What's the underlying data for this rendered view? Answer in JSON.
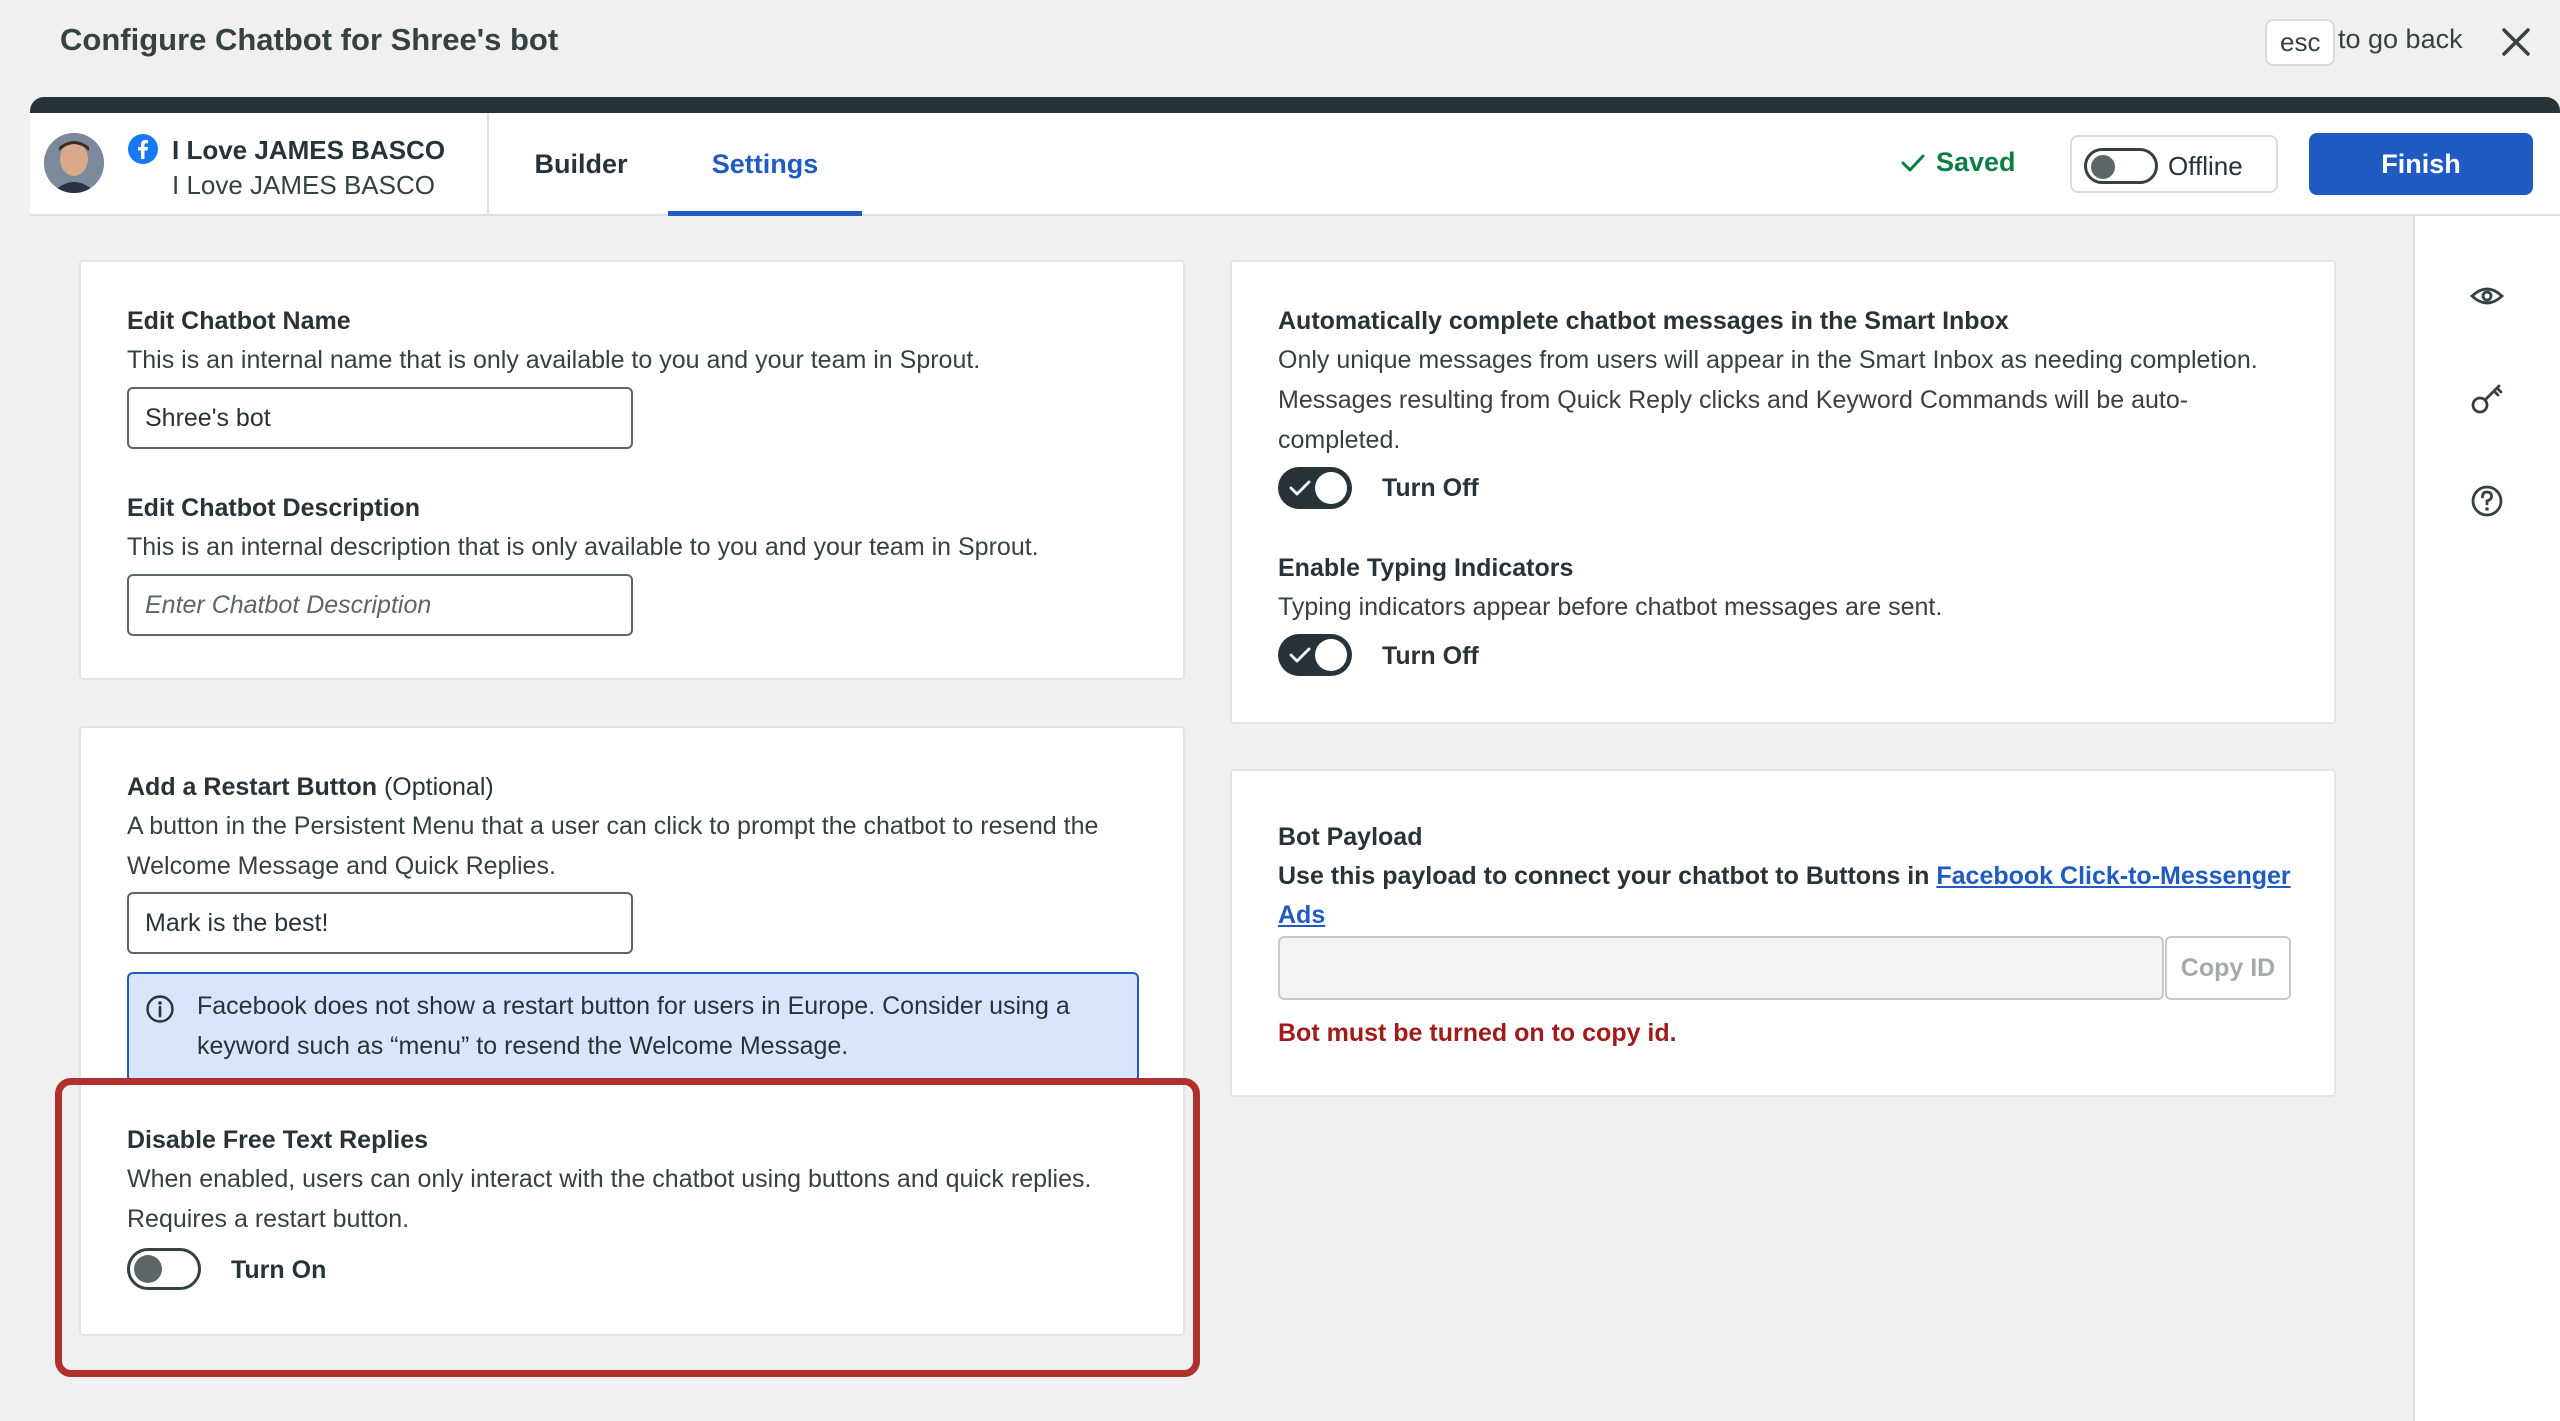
{
  "header": {
    "title": "Configure Chatbot for Shree's bot",
    "esc_key": "esc",
    "esc_hint": "to go back"
  },
  "account": {
    "name": "I Love JAMES BASCO",
    "sub": "I Love JAMES BASCO",
    "network_icon": "facebook-icon"
  },
  "tabs": [
    {
      "label": "Builder",
      "active": false
    },
    {
      "label": "Settings",
      "active": true
    }
  ],
  "status": {
    "saved_label": "Saved",
    "bot_status": "Offline",
    "finish_label": "Finish"
  },
  "rail_icons": [
    "eye-icon",
    "key-icon",
    "help-icon"
  ],
  "settings": {
    "name_section": {
      "title": "Edit Chatbot Name",
      "desc": "This is an internal name that is only available to you and your team in Sprout.",
      "value": "Shree's bot"
    },
    "description_section": {
      "title": "Edit Chatbot Description",
      "desc": "This is an internal description that is only available to you and your team in Sprout.",
      "placeholder": "Enter Chatbot Description"
    },
    "restart_section": {
      "title": "Add a Restart Button",
      "optional": "(Optional)",
      "desc_line1": "A button in the Persistent Menu that a user can click to prompt the chatbot to resend the",
      "desc_line2": "Welcome Message and Quick Replies.",
      "value": "Mark is the best!",
      "info_line1": "Facebook does not show a restart button for users in Europe. Consider using a",
      "info_line2": "keyword such as “menu” to resend the Welcome Message."
    },
    "free_text_section": {
      "title": "Disable Free Text Replies",
      "desc_line1": "When enabled, users can only interact with the chatbot using buttons and quick replies.",
      "desc_line2": "Requires a restart button.",
      "toggle_label": "Turn On",
      "enabled": false
    },
    "auto_complete_section": {
      "title": "Automatically complete chatbot messages in the Smart Inbox",
      "desc_line1": "Only unique messages from users will appear in the Smart Inbox as needing completion.",
      "desc_line2": "Messages resulting from Quick Reply clicks and Keyword Commands will be auto-",
      "desc_line3": "completed.",
      "toggle_label": "Turn Off",
      "enabled": true
    },
    "typing_section": {
      "title": "Enable Typing Indicators",
      "desc": "Typing indicators appear before chatbot messages are sent.",
      "toggle_label": "Turn Off",
      "enabled": true
    },
    "payload_section": {
      "title": "Bot Payload",
      "desc_prefix": "Use this payload to connect your chatbot to Buttons in",
      "link_line1": "Facebook Click-to-Messenger",
      "link_line2": "Ads",
      "copy_label": "Copy ID",
      "error": "Bot must be turned on to copy id."
    }
  },
  "colors": {
    "accent": "#205bc3",
    "dark": "#273338",
    "saved_green": "#0b7f41",
    "error_red": "#a11b1b",
    "highlight_red": "#b0302c"
  }
}
